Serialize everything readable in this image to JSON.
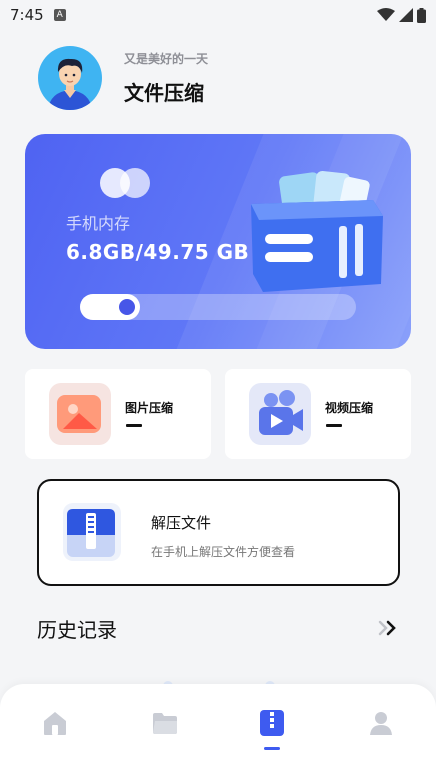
{
  "status_bar": {
    "time": "7:45",
    "indicator": "A"
  },
  "header": {
    "subtitle": "又是美好的一天",
    "title": "文件压缩"
  },
  "storage": {
    "label": "手机内存",
    "value": "6.8GB/49.75 GB",
    "used_fraction": 0.137
  },
  "tools": [
    {
      "label": "图片压缩",
      "icon": "image-icon"
    },
    {
      "label": "视频压缩",
      "icon": "video-camera-icon"
    }
  ],
  "unzip": {
    "title": "解压文件",
    "subtitle": "在手机上解压文件方便查看",
    "icon": "zip-file-icon"
  },
  "history": {
    "title": "历史记录"
  },
  "nav": [
    {
      "icon": "home-icon",
      "active": false
    },
    {
      "icon": "folder-icon",
      "active": false
    },
    {
      "icon": "zip-icon",
      "active": true
    },
    {
      "icon": "profile-icon",
      "active": false
    }
  ],
  "colors": {
    "accent": "#3e5bf0",
    "card_gradient_start": "#4f63f2",
    "card_gradient_end": "#8aa0fa",
    "inactive_nav": "#c9ccd4"
  }
}
